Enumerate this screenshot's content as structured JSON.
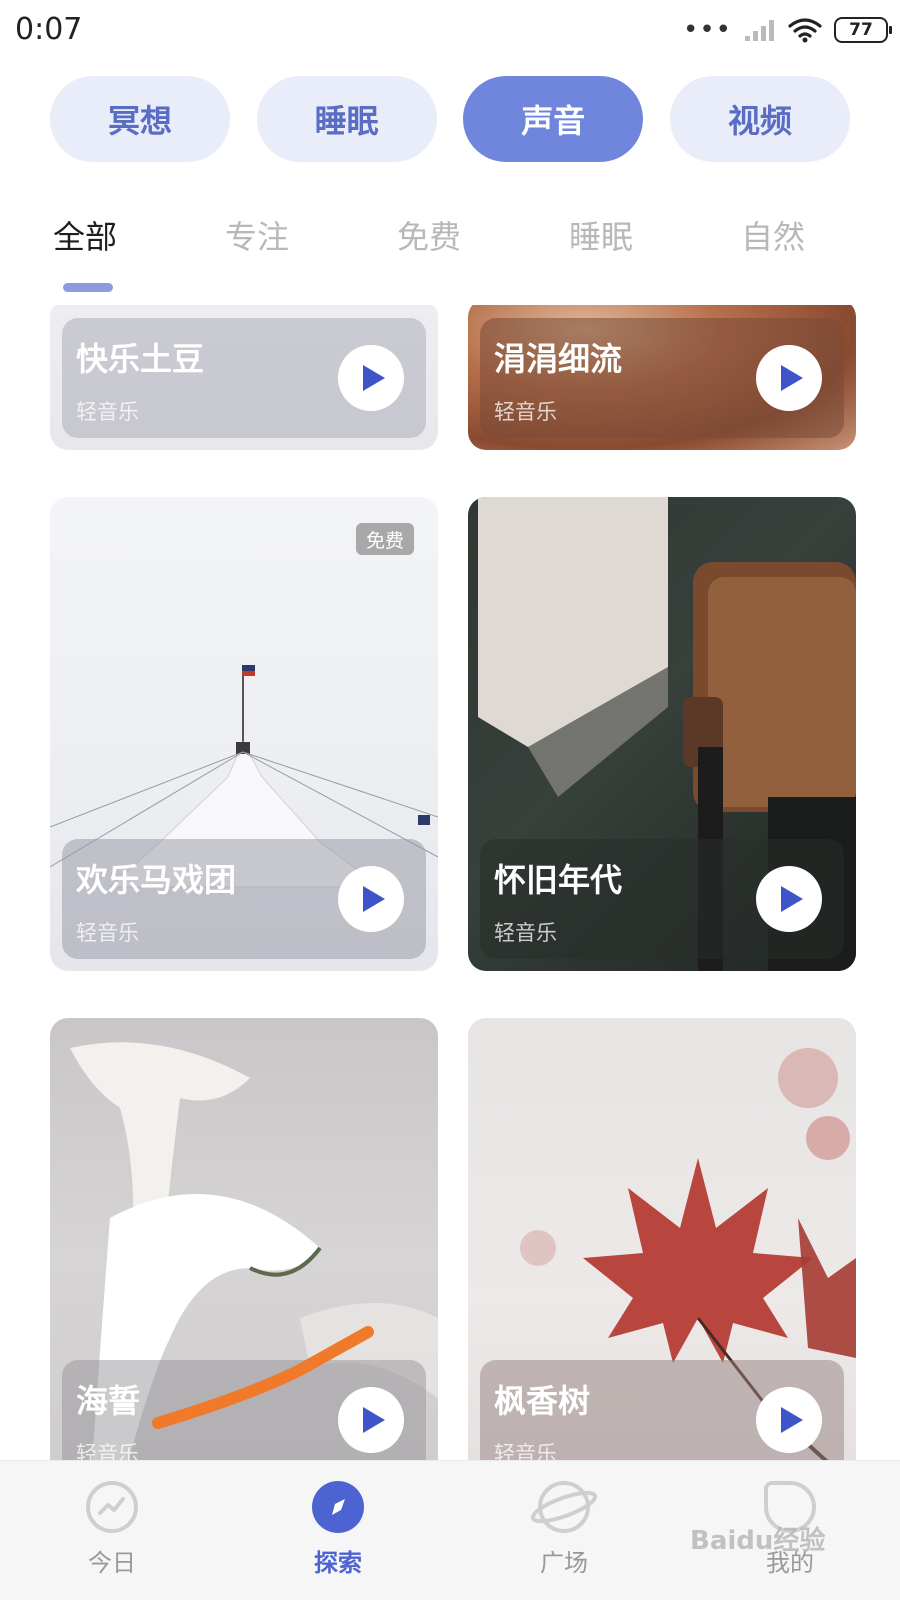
{
  "status_bar": {
    "time": "0:07",
    "battery": "77",
    "icons": [
      "more-dots-icon",
      "signal-icon",
      "wifi-icon",
      "battery-icon"
    ]
  },
  "categories": [
    {
      "label": "冥想",
      "active": false
    },
    {
      "label": "睡眠",
      "active": false
    },
    {
      "label": "声音",
      "active": true
    },
    {
      "label": "视频",
      "active": false
    }
  ],
  "subtabs": [
    {
      "label": "全部",
      "active": true
    },
    {
      "label": "专注",
      "active": false
    },
    {
      "label": "免费",
      "active": false
    },
    {
      "label": "睡眠",
      "active": false
    },
    {
      "label": "自然",
      "active": false
    }
  ],
  "cards": [
    {
      "title": "快乐土豆",
      "subtitle": "轻音乐",
      "badge": ""
    },
    {
      "title": "涓涓细流",
      "subtitle": "轻音乐",
      "badge": ""
    },
    {
      "title": "欢乐马戏团",
      "subtitle": "轻音乐",
      "badge": "免费"
    },
    {
      "title": "怀旧年代",
      "subtitle": "轻音乐",
      "badge": ""
    },
    {
      "title": "海誓",
      "subtitle": "轻音乐",
      "badge": ""
    },
    {
      "title": "枫香树",
      "subtitle": "轻音乐",
      "badge": ""
    }
  ],
  "bottom_nav": [
    {
      "label": "今日",
      "icon": "today-chart-icon",
      "active": false
    },
    {
      "label": "探索",
      "icon": "compass-icon",
      "active": true
    },
    {
      "label": "广场",
      "icon": "planet-icon",
      "active": false
    },
    {
      "label": "我的",
      "icon": "leaf-icon",
      "active": false
    }
  ],
  "watermark": "Baidu经验",
  "colors": {
    "accent": "#6f86dc",
    "pill_bg": "#e9ecf9",
    "play_icon": "#3e54c8",
    "nav_active": "#4e63d2",
    "annotation": "#f07a2a"
  }
}
